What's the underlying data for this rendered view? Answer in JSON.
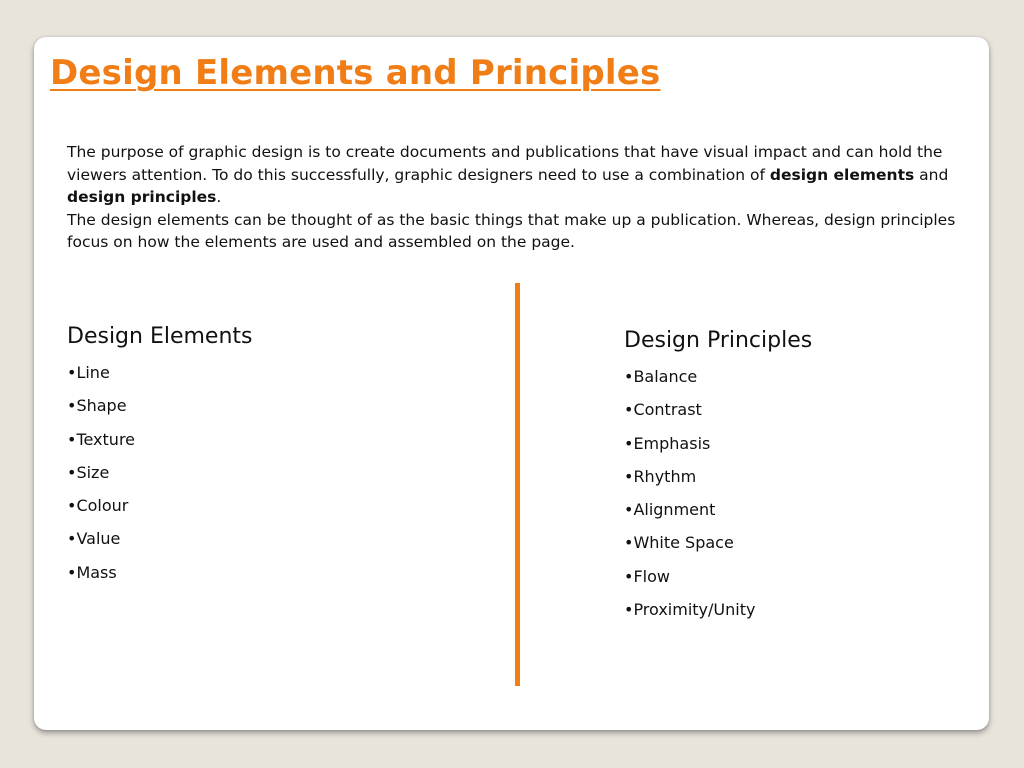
{
  "slide": {
    "title": "Design Elements and Principles",
    "intro": {
      "text_1": "The purpose of graphic design is to create documents and publications that have visual impact and can hold the viewers attention.  To do this successfully, graphic designers need to use a combination of ",
      "bold_1": "design elements",
      "text_2": " and ",
      "bold_2": "design principles",
      "text_3": ".",
      "paragraph_2": "The design elements can be thought of as the basic things that make up a publication. Whereas, design principles focus on how the elements are used and assembled on the page."
    },
    "accent_color": "#f07d15",
    "background_color": "#e8e4dc",
    "left_column": {
      "heading": "Design Elements",
      "items": [
        "•Line",
        "•Shape",
        "•Texture",
        "•Size",
        "•Colour",
        "•Value",
        "•Mass"
      ]
    },
    "right_column": {
      "heading": "Design Principles",
      "items": [
        "•Balance",
        "•Contrast",
        "•Emphasis",
        "•Rhythm",
        "•Alignment",
        "•White Space",
        "•Flow",
        "•Proximity/Unity"
      ]
    }
  }
}
